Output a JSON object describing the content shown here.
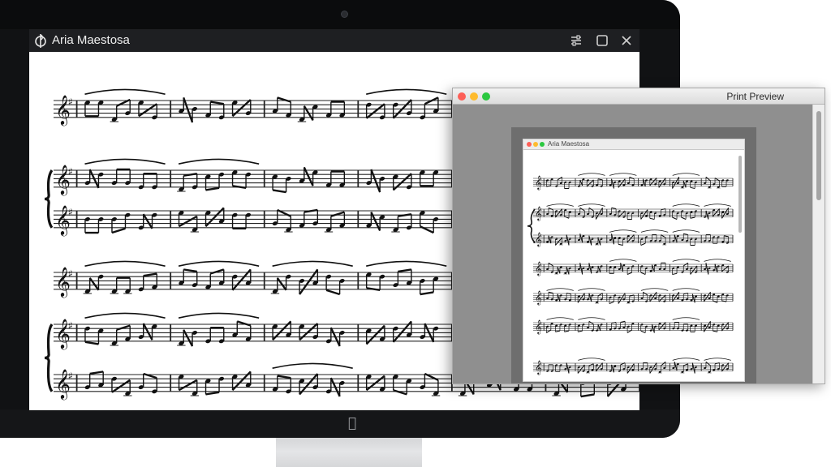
{
  "app": {
    "title": "Aria Maestosa",
    "logo_icon": "treble-clef-logo-icon",
    "controls": [
      "settings-icon",
      "maximize-icon",
      "close-icon"
    ]
  },
  "print_preview": {
    "title": "Print Preview",
    "inner_window_title": "Aria Maestosa"
  },
  "colors": {
    "titlebar": "#1e1f22",
    "bezel": "#111214",
    "preview_background": "#8f8f8f",
    "traffic_close": "#fd5f57",
    "traffic_minimize": "#febb2e",
    "traffic_zoom": "#2bc840"
  }
}
